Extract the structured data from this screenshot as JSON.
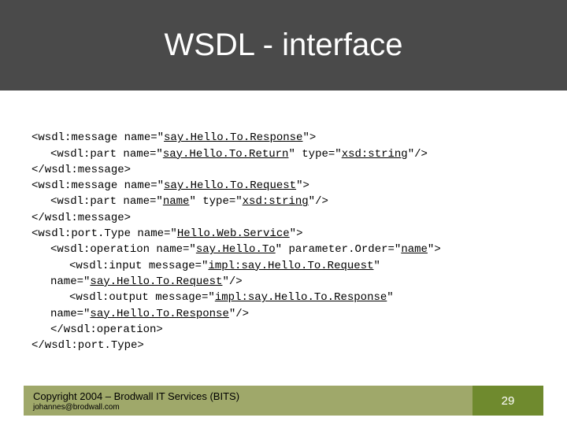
{
  "title": "WSDL - interface",
  "code": {
    "l1a": "<wsdl:message name=\"",
    "l1b": "say.Hello.To.Response",
    "l1c": "\">",
    "l2a": "<wsdl:part name=\"",
    "l2b": "say.Hello.To.Return",
    "l2c": "\" type=\"",
    "l2d": "xsd:string",
    "l2e": "\"/>",
    "l3": "</wsdl:message>",
    "l4a": "<wsdl:message name=\"",
    "l4b": "say.Hello.To.Request",
    "l4c": "\">",
    "l5a": "<wsdl:part name=\"",
    "l5b": "name",
    "l5c": "\" type=\"",
    "l5d": "xsd:string",
    "l5e": "\"/>",
    "l6": "</wsdl:message>",
    "l7a": "<wsdl:port.Type name=\"",
    "l7b": "Hello.Web.Service",
    "l7c": "\">",
    "l8a": "<wsdl:operation name=\"",
    "l8b": "say.Hello.To",
    "l8c": "\" parameter.Order=\"",
    "l8d": "name",
    "l8e": "\">",
    "l9a": "<wsdl:input message=\"",
    "l9b": "impl:say.Hello.To.Request",
    "l9c": "\"",
    "l10a": "name=\"",
    "l10b": "say.Hello.To.Request",
    "l10c": "\"/>",
    "l11a": "<wsdl:output message=\"",
    "l11b": "impl:say.Hello.To.Response",
    "l11c": "\"",
    "l12a": "name=\"",
    "l12b": "say.Hello.To.Response",
    "l12c": "\"/>",
    "l13": "</wsdl:operation>",
    "l14": "</wsdl:port.Type>"
  },
  "footer": {
    "copyright": "Copyright 2004 – Brodwall IT Services (BITS)",
    "email": "johannes@brodwall.com",
    "page": "29"
  }
}
